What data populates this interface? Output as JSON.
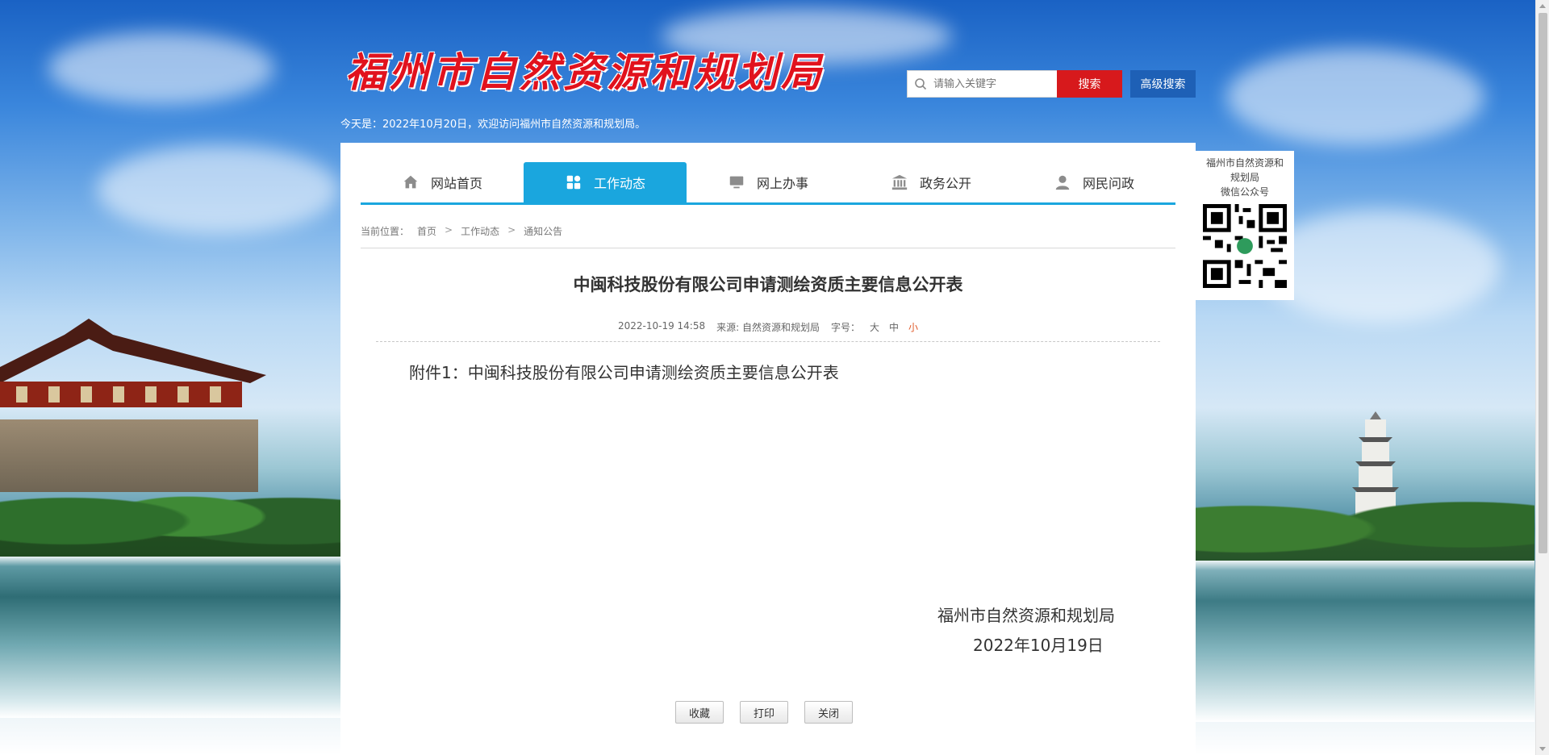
{
  "header": {
    "logo_text": "福州市自然资源和规划局",
    "today_text": "今天是：2022年10月20日，欢迎访问福州市自然资源和规划局。",
    "search_placeholder": "请输入关键字",
    "search_button": "搜索",
    "advanced_search_button": "高级搜索"
  },
  "nav": {
    "items": [
      {
        "label": "网站首页",
        "icon": "home-icon"
      },
      {
        "label": "工作动态",
        "icon": "grid-icon",
        "active": true
      },
      {
        "label": "网上办事",
        "icon": "monitor-icon"
      },
      {
        "label": "政务公开",
        "icon": "bank-icon"
      },
      {
        "label": "网民问政",
        "icon": "user-icon"
      }
    ]
  },
  "breadcrumb": {
    "prefix": "当前位置：",
    "items": [
      "首页",
      "工作动态",
      "通知公告"
    ]
  },
  "article": {
    "title": "中闽科技股份有限公司申请测绘资质主要信息公开表",
    "date": "2022-10-19 14:58",
    "source": "来源: 自然资源和规划局",
    "font_size_label": "字号：",
    "font_sizes": [
      "大",
      "中",
      "小"
    ],
    "attachment": "附件1：中闽科技股份有限公司申请测绘资质主要信息公开表",
    "signature_org": "福州市自然资源和规划局",
    "signature_date": "2022年10月19日"
  },
  "actions": {
    "favorite": "收藏",
    "print": "打印",
    "close": "关闭"
  },
  "qr_widget": {
    "line1": "福州市自然资源和",
    "line2": "规划局",
    "line3": "微信公众号"
  },
  "colors": {
    "nav_active": "#1aa6de",
    "search_button": "#d7191c",
    "advanced_search_button": "#1e60b6",
    "logo": "#e1121d"
  }
}
